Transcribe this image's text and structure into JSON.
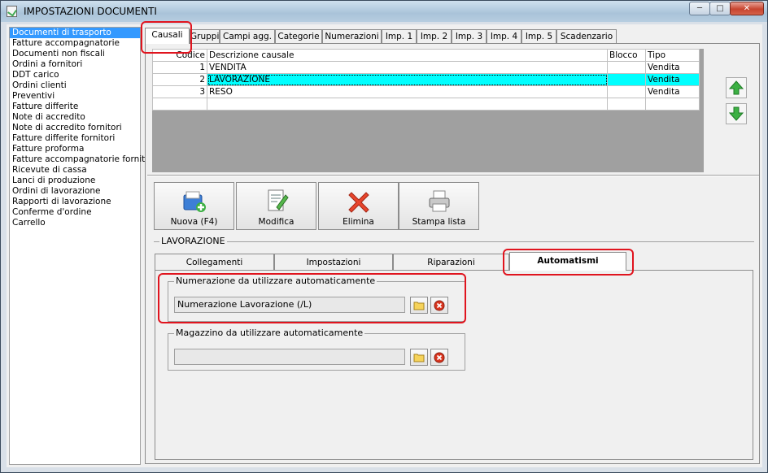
{
  "window": {
    "title": "IMPOSTAZIONI DOCUMENTI"
  },
  "sidebar": {
    "items": [
      {
        "label": "Documenti di trasporto",
        "selected": true
      },
      {
        "label": "Fatture accompagnatorie"
      },
      {
        "label": "Documenti non fiscali"
      },
      {
        "label": "Ordini a fornitori"
      },
      {
        "label": "DDT carico"
      },
      {
        "label": "Ordini clienti"
      },
      {
        "label": "Preventivi"
      },
      {
        "label": "Fatture differite"
      },
      {
        "label": "Note di accredito"
      },
      {
        "label": "Note di accredito fornitori"
      },
      {
        "label": "Fatture differite fornitori"
      },
      {
        "label": "Fatture proforma"
      },
      {
        "label": "Fatture accompagnatorie fornitori"
      },
      {
        "label": "Ricevute di cassa"
      },
      {
        "label": "Lanci di produzione"
      },
      {
        "label": "Ordini di lavorazione"
      },
      {
        "label": "Rapporti di lavorazione"
      },
      {
        "label": "Conferme d'ordine"
      },
      {
        "label": "Carrello"
      }
    ]
  },
  "tabs": [
    {
      "label": "Causali",
      "active": true
    },
    {
      "label": "Gruppi"
    },
    {
      "label": "Campi agg."
    },
    {
      "label": "Categorie"
    },
    {
      "label": "Numerazioni"
    },
    {
      "label": "Imp. 1"
    },
    {
      "label": "Imp. 2"
    },
    {
      "label": "Imp. 3"
    },
    {
      "label": "Imp. 4"
    },
    {
      "label": "Imp. 5"
    },
    {
      "label": "Scadenzario"
    }
  ],
  "grid": {
    "headers": {
      "code": "Codice",
      "description": "Descrizione causale",
      "block": "Blocco",
      "type": "Tipo"
    },
    "rows": [
      {
        "code": "1",
        "description": "VENDITA",
        "block": "",
        "type": "Vendita"
      },
      {
        "code": "2",
        "description": "LAVORAZIONE",
        "block": "",
        "type": "Vendita",
        "selected": true
      },
      {
        "code": "3",
        "description": "RESO",
        "block": "",
        "type": "Vendita"
      }
    ]
  },
  "toolbar": {
    "new_label": "Nuova (F4)",
    "edit_label": "Modifica",
    "delete_label": "Elimina",
    "print_label": "Stampa lista"
  },
  "details": {
    "group_title": "LAVORAZIONE",
    "subtabs": [
      {
        "label": "Collegamenti"
      },
      {
        "label": "Impostazioni"
      },
      {
        "label": "Riparazioni"
      },
      {
        "label": "Automatismi",
        "active": true
      }
    ],
    "numbering": {
      "legend": "Numerazione da utilizzare automaticamente",
      "value": "Numerazione Lavorazione (/L)"
    },
    "warehouse": {
      "legend": "Magazzino da utilizzare automaticamente",
      "value": ""
    }
  },
  "colors": {
    "selection": "#3399ff",
    "row_highlight": "#00ffff",
    "annotation": "#e0141e"
  }
}
